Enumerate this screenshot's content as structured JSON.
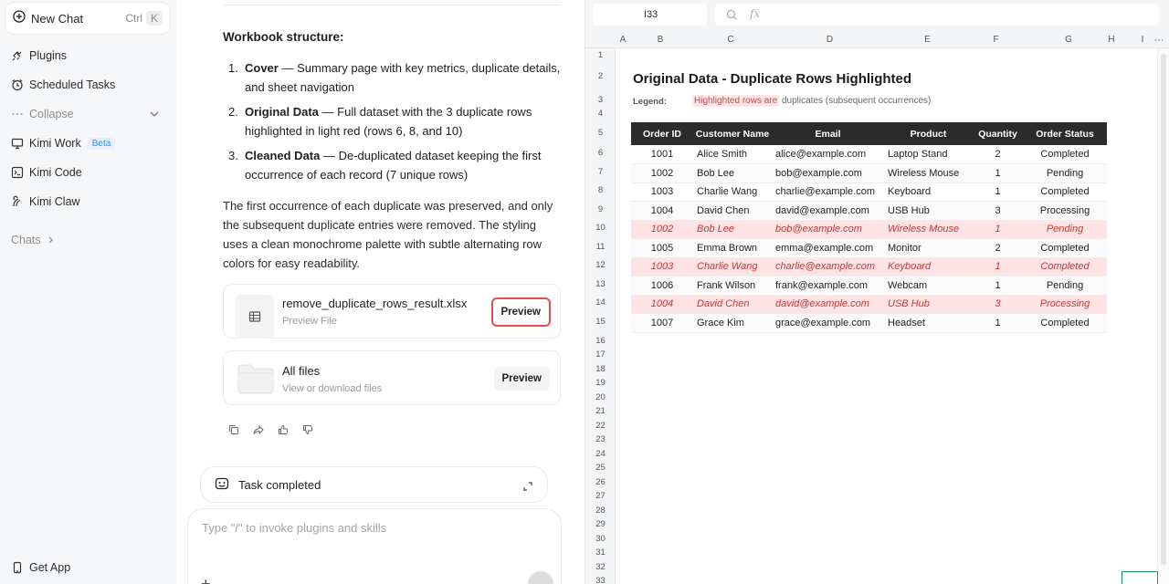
{
  "sidebar": {
    "new_chat": "New Chat",
    "shortcut_ctrl": "Ctrl",
    "shortcut_k": "K",
    "items": [
      {
        "label": "Plugins",
        "icon": "plug-icon"
      },
      {
        "label": "Scheduled Tasks",
        "icon": "clock-icon"
      },
      {
        "label": "Collapse",
        "icon": "dots-icon"
      },
      {
        "label": "Kimi Work",
        "icon": "monitor-icon",
        "badge": "Beta"
      },
      {
        "label": "Kimi Code",
        "icon": "terminal-icon"
      },
      {
        "label": "Kimi Claw",
        "icon": "claw-icon"
      }
    ],
    "chats_label": "Chats",
    "get_app": "Get App"
  },
  "chat": {
    "heading": "Workbook structure:",
    "list": [
      {
        "num": "1.",
        "bold": "Cover",
        "text": " — Summary page with key metrics, duplicate details, and sheet navigation"
      },
      {
        "num": "2.",
        "bold": "Original Data",
        "text": " — Full dataset with the 3 duplicate rows highlighted in light red (rows 6, 8, and 10)"
      },
      {
        "num": "3.",
        "bold": "Cleaned Data",
        "text": " — De-duplicated dataset keeping the first occurrence of each record (7 unique rows)"
      }
    ],
    "paragraph": "The first occurrence of each duplicate was preserved, and only the subsequent duplicate entries were removed. The styling uses a clean monochrome palette with subtle alternating row colors for easy readability.",
    "file_card": {
      "name": "remove_duplicate_rows_result.xlsx",
      "sub": "Preview File",
      "button": "Preview"
    },
    "all_files": {
      "name": "All files",
      "sub": "View or download files",
      "button": "Preview"
    },
    "task_status": "Task completed",
    "input_placeholder": "Type \"/\" to invoke plugins and skills"
  },
  "sheet": {
    "cell_ref": "I33",
    "fx": "fx",
    "columns": [
      "A",
      "B",
      "C",
      "D",
      "E",
      "F",
      "G",
      "H",
      "I"
    ],
    "rows": [
      "1",
      "2",
      "3",
      "4",
      "5",
      "6",
      "7",
      "8",
      "9",
      "10",
      "11",
      "12",
      "13",
      "14",
      "15",
      "16",
      "17",
      "18",
      "19",
      "20",
      "21",
      "22",
      "23",
      "24",
      "25",
      "26",
      "27",
      "28",
      "29",
      "30",
      "31",
      "32",
      "33"
    ],
    "title": "Original Data  -  Duplicate Rows Highlighted",
    "legend_label": "Legend:",
    "legend_highlight": "Highlighted rows are",
    "legend_rest": " duplicates (subsequent occurrences)",
    "headers": [
      "Order ID",
      "Customer Name",
      "Email",
      "Product",
      "Quantity",
      "Order Status"
    ],
    "data_rows": [
      {
        "dup": false,
        "cells": [
          "1001",
          "Alice Smith",
          "alice@example.com",
          "Laptop Stand",
          "2",
          "Completed"
        ]
      },
      {
        "dup": false,
        "cells": [
          "1002",
          "Bob Lee",
          "bob@example.com",
          "Wireless Mouse",
          "1",
          "Pending"
        ]
      },
      {
        "dup": false,
        "cells": [
          "1003",
          "Charlie Wang",
          "charlie@example.com",
          "Keyboard",
          "1",
          "Completed"
        ]
      },
      {
        "dup": false,
        "cells": [
          "1004",
          "David Chen",
          "david@example.com",
          "USB Hub",
          "3",
          "Processing"
        ]
      },
      {
        "dup": true,
        "cells": [
          "1002",
          "Bob Lee",
          "bob@example.com",
          "Wireless Mouse",
          "1",
          "Pending"
        ]
      },
      {
        "dup": false,
        "cells": [
          "1005",
          "Emma Brown",
          "emma@example.com",
          "Monitor",
          "2",
          "Completed"
        ]
      },
      {
        "dup": true,
        "cells": [
          "1003",
          "Charlie Wang",
          "charlie@example.com",
          "Keyboard",
          "1",
          "Completed"
        ]
      },
      {
        "dup": false,
        "cells": [
          "1006",
          "Frank Wilson",
          "frank@example.com",
          "Webcam",
          "1",
          "Pending"
        ]
      },
      {
        "dup": true,
        "cells": [
          "1004",
          "David Chen",
          "david@example.com",
          "USB Hub",
          "3",
          "Processing"
        ]
      },
      {
        "dup": false,
        "cells": [
          "1007",
          "Grace Kim",
          "grace@example.com",
          "Headset",
          "1",
          "Completed"
        ]
      }
    ],
    "colors": {
      "header_bg": "#2b2b2b",
      "dup_bg": "#fde3e3",
      "dup_text": "#c23838",
      "highlight_border": "#e74b4b"
    }
  }
}
